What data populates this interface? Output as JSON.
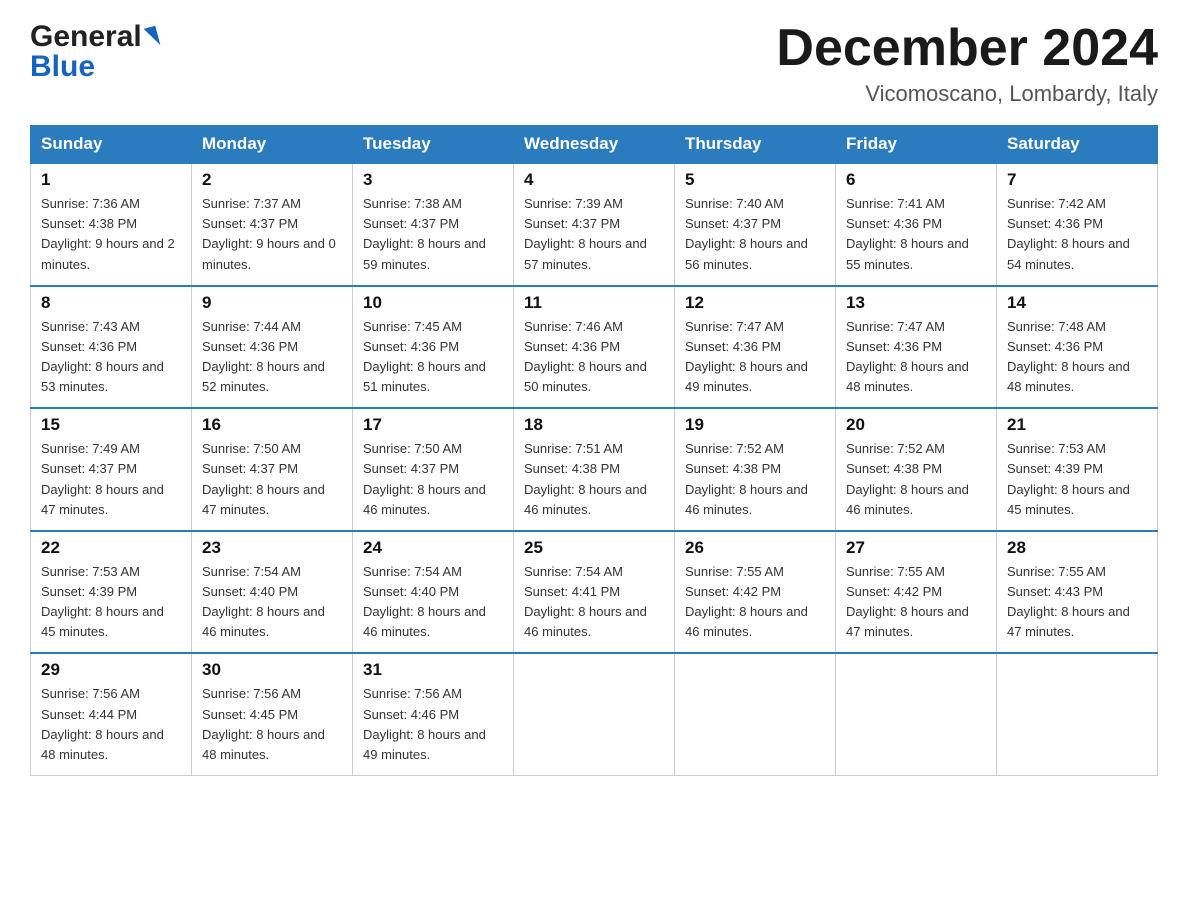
{
  "header": {
    "logo_general": "General",
    "logo_blue": "Blue",
    "month_title": "December 2024",
    "location": "Vicomoscano, Lombardy, Italy"
  },
  "days_of_week": [
    "Sunday",
    "Monday",
    "Tuesday",
    "Wednesday",
    "Thursday",
    "Friday",
    "Saturday"
  ],
  "weeks": [
    [
      {
        "day": "1",
        "sunrise": "7:36 AM",
        "sunset": "4:38 PM",
        "daylight": "9 hours and 2 minutes."
      },
      {
        "day": "2",
        "sunrise": "7:37 AM",
        "sunset": "4:37 PM",
        "daylight": "9 hours and 0 minutes."
      },
      {
        "day": "3",
        "sunrise": "7:38 AM",
        "sunset": "4:37 PM",
        "daylight": "8 hours and 59 minutes."
      },
      {
        "day": "4",
        "sunrise": "7:39 AM",
        "sunset": "4:37 PM",
        "daylight": "8 hours and 57 minutes."
      },
      {
        "day": "5",
        "sunrise": "7:40 AM",
        "sunset": "4:37 PM",
        "daylight": "8 hours and 56 minutes."
      },
      {
        "day": "6",
        "sunrise": "7:41 AM",
        "sunset": "4:36 PM",
        "daylight": "8 hours and 55 minutes."
      },
      {
        "day": "7",
        "sunrise": "7:42 AM",
        "sunset": "4:36 PM",
        "daylight": "8 hours and 54 minutes."
      }
    ],
    [
      {
        "day": "8",
        "sunrise": "7:43 AM",
        "sunset": "4:36 PM",
        "daylight": "8 hours and 53 minutes."
      },
      {
        "day": "9",
        "sunrise": "7:44 AM",
        "sunset": "4:36 PM",
        "daylight": "8 hours and 52 minutes."
      },
      {
        "day": "10",
        "sunrise": "7:45 AM",
        "sunset": "4:36 PM",
        "daylight": "8 hours and 51 minutes."
      },
      {
        "day": "11",
        "sunrise": "7:46 AM",
        "sunset": "4:36 PM",
        "daylight": "8 hours and 50 minutes."
      },
      {
        "day": "12",
        "sunrise": "7:47 AM",
        "sunset": "4:36 PM",
        "daylight": "8 hours and 49 minutes."
      },
      {
        "day": "13",
        "sunrise": "7:47 AM",
        "sunset": "4:36 PM",
        "daylight": "8 hours and 48 minutes."
      },
      {
        "day": "14",
        "sunrise": "7:48 AM",
        "sunset": "4:36 PM",
        "daylight": "8 hours and 48 minutes."
      }
    ],
    [
      {
        "day": "15",
        "sunrise": "7:49 AM",
        "sunset": "4:37 PM",
        "daylight": "8 hours and 47 minutes."
      },
      {
        "day": "16",
        "sunrise": "7:50 AM",
        "sunset": "4:37 PM",
        "daylight": "8 hours and 47 minutes."
      },
      {
        "day": "17",
        "sunrise": "7:50 AM",
        "sunset": "4:37 PM",
        "daylight": "8 hours and 46 minutes."
      },
      {
        "day": "18",
        "sunrise": "7:51 AM",
        "sunset": "4:38 PM",
        "daylight": "8 hours and 46 minutes."
      },
      {
        "day": "19",
        "sunrise": "7:52 AM",
        "sunset": "4:38 PM",
        "daylight": "8 hours and 46 minutes."
      },
      {
        "day": "20",
        "sunrise": "7:52 AM",
        "sunset": "4:38 PM",
        "daylight": "8 hours and 46 minutes."
      },
      {
        "day": "21",
        "sunrise": "7:53 AM",
        "sunset": "4:39 PM",
        "daylight": "8 hours and 45 minutes."
      }
    ],
    [
      {
        "day": "22",
        "sunrise": "7:53 AM",
        "sunset": "4:39 PM",
        "daylight": "8 hours and 45 minutes."
      },
      {
        "day": "23",
        "sunrise": "7:54 AM",
        "sunset": "4:40 PM",
        "daylight": "8 hours and 46 minutes."
      },
      {
        "day": "24",
        "sunrise": "7:54 AM",
        "sunset": "4:40 PM",
        "daylight": "8 hours and 46 minutes."
      },
      {
        "day": "25",
        "sunrise": "7:54 AM",
        "sunset": "4:41 PM",
        "daylight": "8 hours and 46 minutes."
      },
      {
        "day": "26",
        "sunrise": "7:55 AM",
        "sunset": "4:42 PM",
        "daylight": "8 hours and 46 minutes."
      },
      {
        "day": "27",
        "sunrise": "7:55 AM",
        "sunset": "4:42 PM",
        "daylight": "8 hours and 47 minutes."
      },
      {
        "day": "28",
        "sunrise": "7:55 AM",
        "sunset": "4:43 PM",
        "daylight": "8 hours and 47 minutes."
      }
    ],
    [
      {
        "day": "29",
        "sunrise": "7:56 AM",
        "sunset": "4:44 PM",
        "daylight": "8 hours and 48 minutes."
      },
      {
        "day": "30",
        "sunrise": "7:56 AM",
        "sunset": "4:45 PM",
        "daylight": "8 hours and 48 minutes."
      },
      {
        "day": "31",
        "sunrise": "7:56 AM",
        "sunset": "4:46 PM",
        "daylight": "8 hours and 49 minutes."
      },
      null,
      null,
      null,
      null
    ]
  ],
  "labels": {
    "sunrise": "Sunrise:",
    "sunset": "Sunset:",
    "daylight": "Daylight:"
  }
}
